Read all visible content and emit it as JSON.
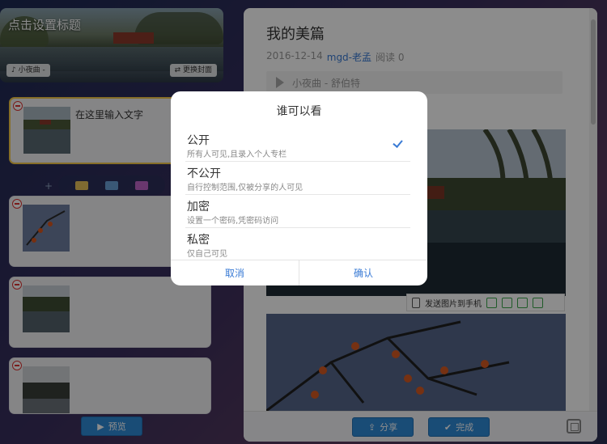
{
  "editor": {
    "cover_title": "点击设置标题",
    "music_chip": "♪ 小夜曲 -",
    "change_cover": "⇄ 更换封面",
    "first_card_text": "在这里输入文字",
    "preview_label": "预览"
  },
  "article": {
    "title": "我的美篇",
    "date": "2016-12-14",
    "author": "mgd-老孟",
    "reads": "阅读 0",
    "music": "小夜曲 - 舒伯特",
    "toolbar_send": "发送图片到手机",
    "share_label": "分享",
    "done_label": "完成"
  },
  "modal": {
    "title": "谁可以看",
    "options": [
      {
        "label": "公开",
        "desc": "所有人可见,且录入个人专栏",
        "selected": true
      },
      {
        "label": "不公开",
        "desc": "自行控制范围,仅被分享的人可见",
        "selected": false
      },
      {
        "label": "加密",
        "desc": "设置一个密码,凭密码访问",
        "selected": false
      },
      {
        "label": "私密",
        "desc": "仅自己可见",
        "selected": false
      }
    ],
    "cancel": "取消",
    "confirm": "确认"
  },
  "colors": {
    "accent": "#3a7bd5",
    "button_blue": "#2f8ad8",
    "selected_border": "#f4c94a",
    "remove_red": "#dd3333"
  }
}
